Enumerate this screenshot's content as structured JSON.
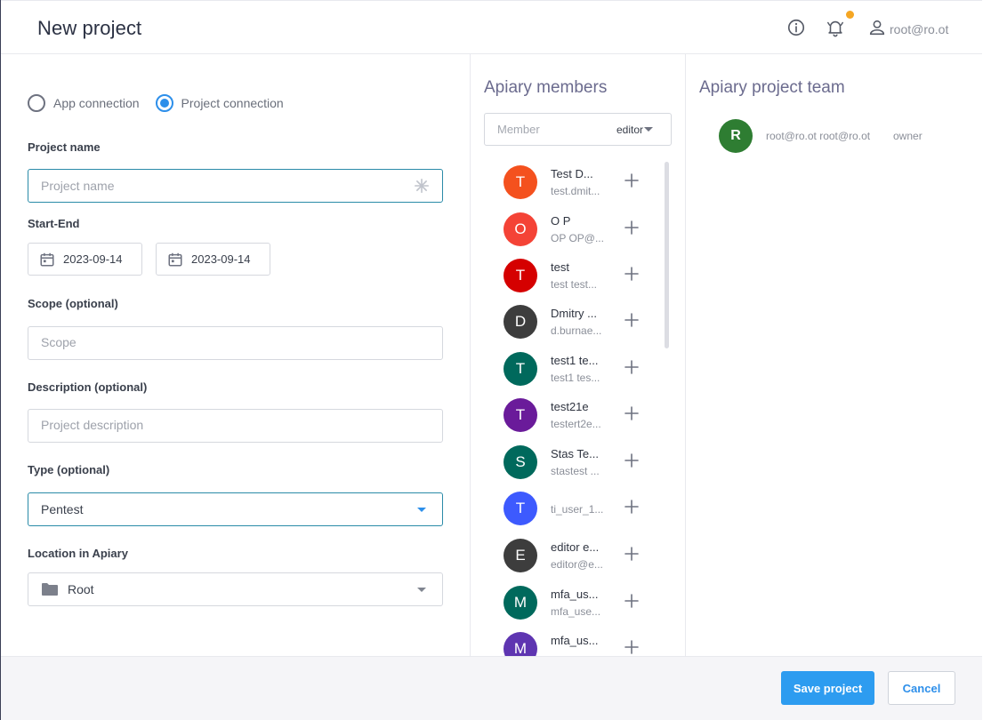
{
  "header": {
    "title": "New project",
    "icons": [
      "info-icon",
      "bell-icon",
      "user-icon"
    ],
    "user": "root@ro.ot",
    "notification_dot_color": "#f5a623"
  },
  "form": {
    "connection": {
      "options": [
        "App connection",
        "Project connection"
      ],
      "selected": "Project connection"
    },
    "project_name": {
      "label": "Project name",
      "placeholder": "Project name"
    },
    "start_end": {
      "label": "Start-End",
      "start": "2023-09-14",
      "end": "2023-09-14"
    },
    "scope": {
      "label": "Scope (optional)",
      "placeholder": "Scope"
    },
    "description": {
      "label": "Description (optional)",
      "placeholder": "Project description"
    },
    "type": {
      "label": "Type (optional)",
      "value": "Pentest"
    },
    "location": {
      "label": "Location in Apiary",
      "value": "Root"
    }
  },
  "members": {
    "title": "Apiary members",
    "search_placeholder": "Member",
    "role": "editor",
    "items": [
      {
        "initial": "T",
        "name": "Test D...",
        "email": "test.dmit...",
        "color": "#f4511e"
      },
      {
        "initial": "O",
        "name": "O P",
        "email": "OP OP@...",
        "color": "#f44336"
      },
      {
        "initial": "T",
        "name": "test",
        "email": "test test...",
        "color": "#d50000"
      },
      {
        "initial": "D",
        "name": "Dmitry ...",
        "email": "d.burnae...",
        "color": "#3d3d3d"
      },
      {
        "initial": "T",
        "name": "test1 te...",
        "email": "test1 tes...",
        "color": "#00695c"
      },
      {
        "initial": "T",
        "name": "test21e",
        "email": "testert2e...",
        "color": "#6a1b9a"
      },
      {
        "initial": "S",
        "name": "Stas Te...",
        "email": "stastest ...",
        "color": "#00695c"
      },
      {
        "initial": "T",
        "name": "",
        "email": "ti_user_1...",
        "color": "#3d5afe"
      },
      {
        "initial": "E",
        "name": "editor e...",
        "email": "editor@e...",
        "color": "#3d3d3d"
      },
      {
        "initial": "M",
        "name": "mfa_us...",
        "email": "mfa_use...",
        "color": "#00695c"
      },
      {
        "initial": "M",
        "name": "mfa_us...",
        "email": "",
        "color": "#5e35b1"
      }
    ]
  },
  "team": {
    "title": "Apiary project team",
    "members": [
      {
        "initial": "R",
        "name": "root@ro.ot root@ro.ot",
        "role": "owner",
        "color": "#2e7d32"
      }
    ]
  },
  "footer": {
    "save_label": "Save project",
    "cancel_label": "Cancel"
  }
}
